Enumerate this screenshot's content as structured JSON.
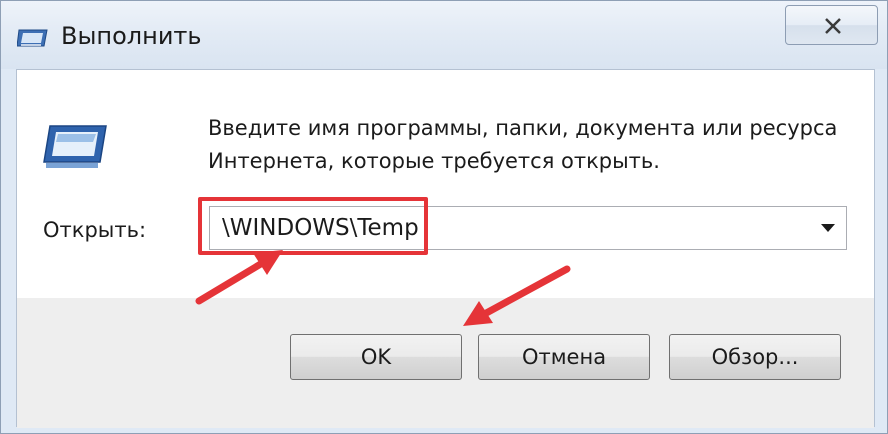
{
  "window": {
    "title": "Выполнить",
    "close_symbol": "✕"
  },
  "dialog": {
    "description_line1": "Введите имя программы, папки, документа или ресурса",
    "description_line2": "Интернета, которые требуется открыть.",
    "open_label": "Открыть:",
    "open_value": "\\WINDOWS\\Temp"
  },
  "buttons": {
    "ok": "OK",
    "cancel": "Отмена",
    "browse": "Обзор..."
  },
  "icons": {
    "title": "run-icon",
    "dialog": "run-icon",
    "close": "close-icon",
    "dropdown": "chevron-down-icon"
  },
  "colors": {
    "annotation": "#e53438",
    "titlebar": "#dfe9f5",
    "bottom_band": "#eeeeee"
  }
}
